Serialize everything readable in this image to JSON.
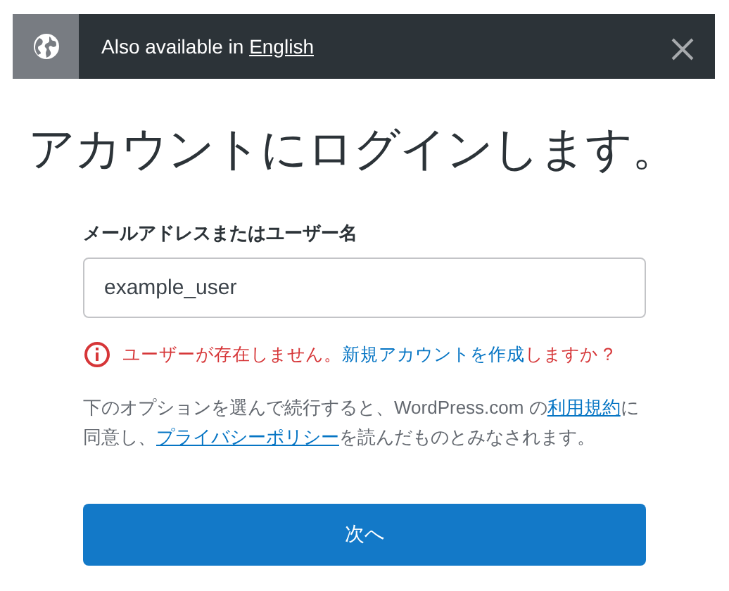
{
  "banner": {
    "text": "Also available in",
    "link": "English"
  },
  "heading": "アカウントにログインします。",
  "field": {
    "label": "メールアドレスまたはユーザー名",
    "value": "example_user"
  },
  "error": [
    {
      "kind": "text",
      "text": "ユーザーが存在しません。"
    },
    {
      "kind": "link",
      "text": "新規アカウントを作成"
    },
    {
      "kind": "text",
      "text": "しますか ?"
    }
  ],
  "terms": [
    {
      "kind": "text",
      "text": "下のオプションを選んで続行すると、WordPress.com の"
    },
    {
      "kind": "link",
      "text": "利用規約"
    },
    {
      "kind": "text",
      "text": "に同意し、"
    },
    {
      "kind": "link",
      "text": "プライバシーポリシー"
    },
    {
      "kind": "text",
      "text": "を読んだものとみなされます。"
    }
  ],
  "button": "次へ"
}
